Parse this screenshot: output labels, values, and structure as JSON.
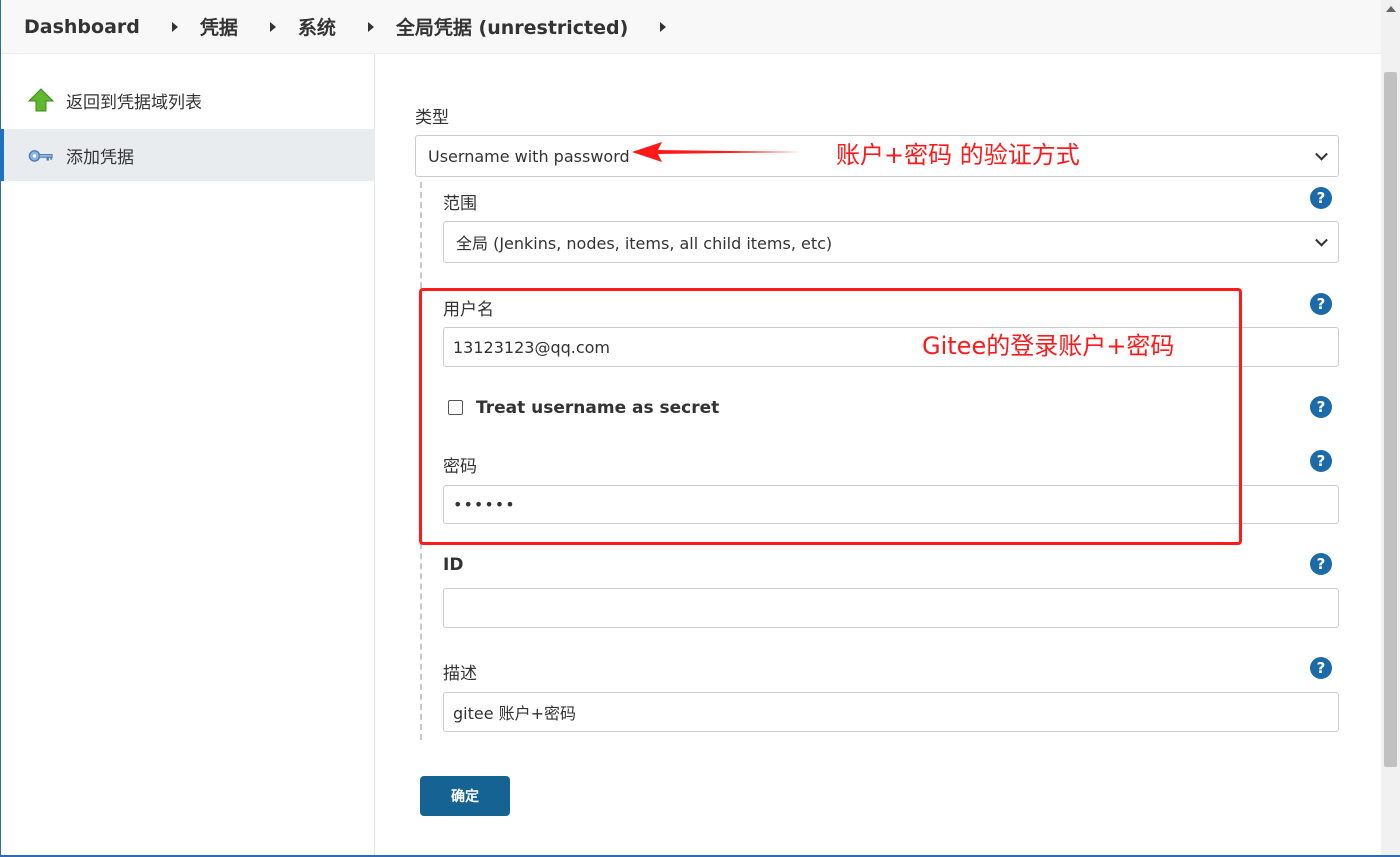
{
  "breadcrumb": [
    "Dashboard",
    "凭据",
    "系统",
    "全局凭据 (unrestricted)"
  ],
  "sidebar": {
    "items": [
      {
        "label": "返回到凭据域列表",
        "icon": "up-arrow-icon"
      },
      {
        "label": "添加凭据",
        "icon": "key-icon"
      }
    ]
  },
  "form": {
    "kind_label": "类型",
    "kind_value": "Username with password",
    "scope_label": "范围",
    "scope_value": "全局 (Jenkins, nodes, items, all child items, etc)",
    "username_label": "用户名",
    "username_value": "13123123@qq.com",
    "treat_secret_label": "Treat username as secret",
    "password_label": "密码",
    "password_value": "••••••",
    "id_label": "ID",
    "id_value": "",
    "description_label": "描述",
    "description_value": "gitee 账户+密码",
    "submit_label": "确定",
    "help_symbol": "?"
  },
  "annotations": {
    "kind_note": "账户+密码 的验证方式",
    "credentials_note": "Gitee的登录账户+密码"
  },
  "colors": {
    "annotation": "#ff1a1a",
    "help_icon": "#1b6aaa",
    "submit_button": "#156392",
    "active_sidebar_accent": "#1a73c7"
  }
}
